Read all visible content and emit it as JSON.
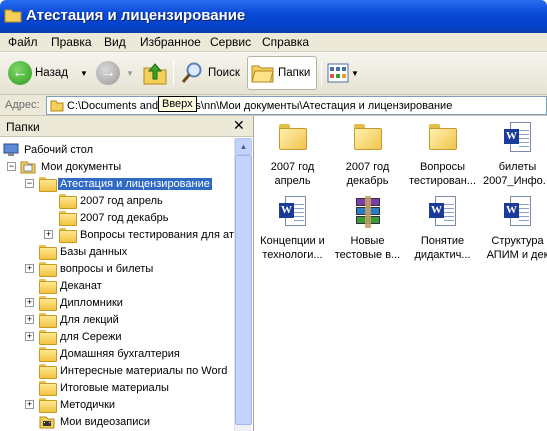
{
  "window": {
    "title": "Атестация и лицензирование"
  },
  "menu": [
    "Файл",
    "Правка",
    "Вид",
    "Избранное",
    "Сервис",
    "Справка"
  ],
  "toolbar": {
    "back_label": "Назад",
    "search_label": "Поиск",
    "folders_label": "Папки",
    "tooltip": "Вверх"
  },
  "address": {
    "label": "Адрес:",
    "path": "C:\\Documents and Settings\\nn\\Мои документы\\Атестация и лицензирование"
  },
  "left_pane": {
    "title": "Папки",
    "tree": [
      {
        "label": "Рабочий стол",
        "icon": "desktop-icon",
        "expander": ""
      },
      {
        "label": "Мои документы",
        "icon": "my-documents-icon",
        "expander": "−"
      },
      {
        "label": "Атестация и лицензирование",
        "icon": "folder-open-icon",
        "expander": "−",
        "selected": true
      },
      {
        "label": "2007 год апрель",
        "icon": "folder-icon",
        "expander": ""
      },
      {
        "label": "2007 год декабрь",
        "icon": "folder-icon",
        "expander": ""
      },
      {
        "label": "Вопросы тестирования для ат",
        "icon": "folder-icon",
        "expander": "+"
      },
      {
        "label": "Базы данных",
        "icon": "folder-icon",
        "expander": ""
      },
      {
        "label": "вопросы и билеты",
        "icon": "folder-icon",
        "expander": "+"
      },
      {
        "label": "Деканат",
        "icon": "folder-icon",
        "expander": ""
      },
      {
        "label": "Дипломники",
        "icon": "folder-icon",
        "expander": "+"
      },
      {
        "label": "Для лекций",
        "icon": "folder-icon",
        "expander": "+"
      },
      {
        "label": "для Сережи",
        "icon": "folder-icon",
        "expander": "+"
      },
      {
        "label": "Домашняя бухгалтерия",
        "icon": "folder-icon",
        "expander": ""
      },
      {
        "label": "Интересные материалы по Word",
        "icon": "folder-icon",
        "expander": ""
      },
      {
        "label": "Итоговые материалы",
        "icon": "folder-icon",
        "expander": ""
      },
      {
        "label": "Методички",
        "icon": "folder-icon",
        "expander": "+"
      },
      {
        "label": "Мои видеозаписи",
        "icon": "video-folder-icon",
        "expander": ""
      }
    ]
  },
  "files": [
    {
      "line1": "2007 год",
      "line2": "апрель",
      "icon": "folder-icon"
    },
    {
      "line1": "2007 год",
      "line2": "декабрь",
      "icon": "folder-icon"
    },
    {
      "line1": "Вопросы",
      "line2": "тестирован...",
      "icon": "folder-icon"
    },
    {
      "line1": "билеты",
      "line2": "2007_Инфо...",
      "icon": "word-document-icon"
    },
    {
      "line1": "Концепции и",
      "line2": "технологи...",
      "icon": "word-document-icon"
    },
    {
      "line1": "Новые",
      "line2": "тестовые в...",
      "icon": "winrar-archive-icon"
    },
    {
      "line1": "Понятие",
      "line2": "дидактич...",
      "icon": "word-document-icon"
    },
    {
      "line1": "Структура",
      "line2": "АПИМ и дек",
      "icon": "word-document-icon"
    }
  ]
}
